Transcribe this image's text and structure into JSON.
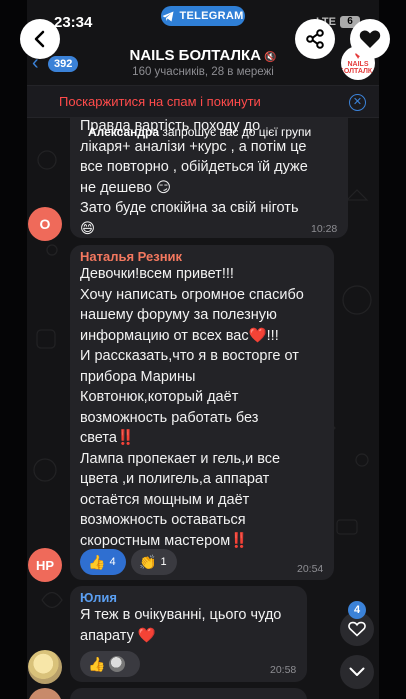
{
  "status": {
    "time": "23:34",
    "pill_label": "TELEGRAM",
    "network": "LTE",
    "battery": "6"
  },
  "header": {
    "unread_count": "392",
    "title": "NAILS БОЛТАЛКА",
    "subtitle": "160 учасників, 28 в мережі",
    "avatar_text": "NAILS БОЛТАЛКА"
  },
  "spam_banner": {
    "text": "Поскаржитися на спам і покинути"
  },
  "messages": [
    {
      "text": "Правда вартість походу до\nлікаря+ аналізи +курс , а потім це\nвсе повторно , обійдеться їй дуже\nне дешево 😏\nЗато буде спокійна за свій ніготь\n😄",
      "system_sender": "Александра",
      "system_text": " запрошує вас до цієї групи",
      "time": "10:28",
      "avatar_initials": "О"
    },
    {
      "sender": "Наталья Резник",
      "text": "Девочки!всем привет!!!\nХочу написать огромное спасибо\nнашему форуму за полезную\nинформацию от всех вас❤️!!!\nИ рассказать,что я в восторге от\nприбора Марины\nКовтонюк,который даёт\nвозможность работать без\nсвета‼️\nЛампа пропекает и гель,и все\nцвета ,и полигель,а аппарат\nостаётся мощным и даёт\nвозможность оставаться\nскоростным мастером‼️",
      "time": "20:54",
      "avatar_initials": "НР",
      "reactions": [
        {
          "emoji": "👍",
          "count": "4"
        },
        {
          "emoji": "👏",
          "count": "1"
        }
      ]
    },
    {
      "sender": "Юлия",
      "text": "Я теж в очікуванні, цього чудо\nапарату ❤️",
      "time": "20:58",
      "reactions": [
        {
          "emoji": "👍"
        }
      ]
    }
  ],
  "floating": {
    "reactions_badge": "4"
  },
  "colors": {
    "accent": "#3b82d8",
    "spam_red": "#ff4b4b",
    "sender_red": "#f3785f",
    "sender_blue": "#5b9ff1",
    "bubble": "#232327",
    "background": "#141416"
  }
}
